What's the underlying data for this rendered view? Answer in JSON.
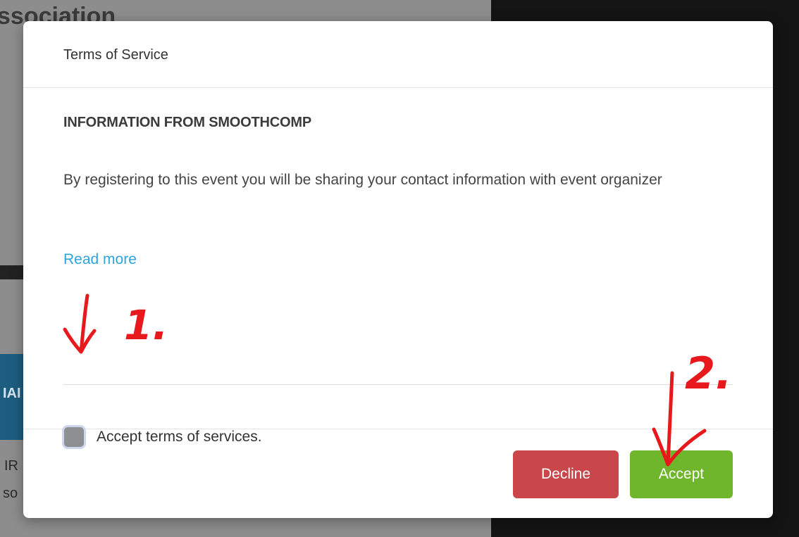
{
  "background": {
    "title_fragment": "ssociation",
    "blue_bar_text": "IAI",
    "text_line1": "IR",
    "text_line2": "so"
  },
  "modal": {
    "title": "Terms of Service",
    "info_heading": "INFORMATION FROM SMOOTHCOMP",
    "info_text": "By registering to this event you will be sharing your contact information with event organizer",
    "read_more": "Read more",
    "checkbox_label": "Accept terms of services.",
    "decline_label": "Decline",
    "accept_label": "Accept"
  },
  "annotations": {
    "label_1": "1.",
    "label_2": "2.",
    "color": "#e8191c"
  },
  "colors": {
    "accept": "#6fb62c",
    "decline": "#c9464a",
    "link": "#2aa5de"
  }
}
